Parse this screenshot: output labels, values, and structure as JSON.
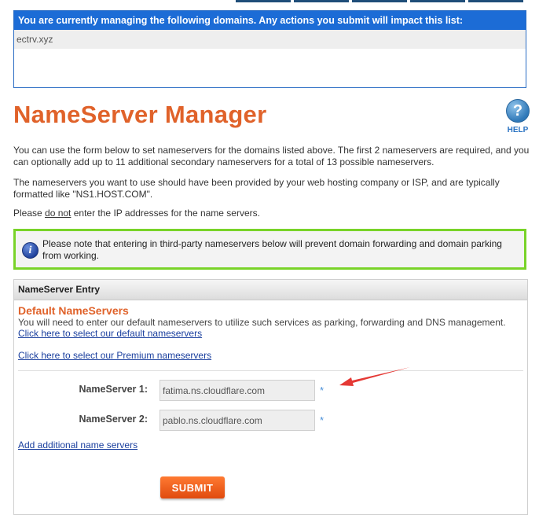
{
  "domains_box": {
    "header": "You are currently managing the following domains. Any actions you submit will impact this list:",
    "domains": [
      "ectrv.xyz"
    ]
  },
  "page": {
    "title": "NameServer Manager",
    "help_label": "HELP",
    "help_icon": "question-mark-icon"
  },
  "intro": {
    "p1": "You can use the form below to set nameservers for the domains listed above. The first 2 nameservers are required, and you can optionally add up to 11 additional secondary nameservers for a total of 13 possible nameservers.",
    "p2": "The nameservers you want to use should have been provided by your web hosting company or ISP, and are typically formatted like \"NS1.HOST.COM\".",
    "p3_before": "Please ",
    "p3_underline": "do not",
    "p3_after": " enter the IP addresses for the name servers."
  },
  "notice": {
    "icon": "info-icon",
    "text": "Please note that entering in third-party nameservers below will prevent domain forwarding and domain parking from working."
  },
  "entry": {
    "header": "NameServer Entry",
    "default_title": "Default NameServers",
    "default_desc": "You will need to enter our default nameservers to utilize such services as parking, forwarding and DNS management.",
    "default_link": "Click here to select our default nameservers",
    "premium_link": "Click here to select our Premium nameservers",
    "ns1_label": "NameServer 1:",
    "ns1_value": "fatima.ns.cloudflare.com",
    "ns2_label": "NameServer 2:",
    "ns2_value": "pablo.ns.cloudflare.com",
    "required_mark": "*",
    "add_link": "Add additional name servers",
    "submit_label": "SUBMIT"
  },
  "colors": {
    "title_orange": "#e0622a",
    "header_blue": "#1c6cd6",
    "notice_green": "#79d329",
    "link_blue": "#1a3f9e",
    "annotation_red": "#e53935"
  }
}
